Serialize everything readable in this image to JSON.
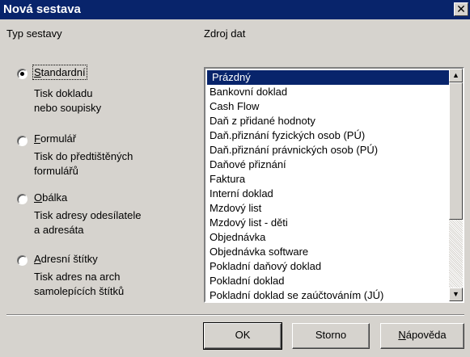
{
  "window": {
    "title": "Nová sestava",
    "close_glyph": "✕"
  },
  "left_panel": {
    "heading": "Typ sestavy",
    "options": [
      {
        "accel": "S",
        "rest": "tandardní",
        "desc1": "Tisk dokladu",
        "desc2": "nebo soupisky",
        "selected": true
      },
      {
        "accel": "F",
        "rest": "ormulář",
        "desc1": "Tisk do předtištěných",
        "desc2": "formulářů",
        "selected": false
      },
      {
        "accel": "O",
        "rest": "bálka",
        "desc1": "Tisk adresy odesílatele",
        "desc2": "a adresáta",
        "selected": false
      },
      {
        "accel": "A",
        "rest": "dresní štítky",
        "desc1": "Tisk adres na arch",
        "desc2": "samolepících štítků",
        "selected": false
      }
    ]
  },
  "right_panel": {
    "heading": "Zdroj dat",
    "items": [
      "Prázdný",
      "Bankovní doklad",
      "Cash Flow",
      "Daň z přidané hodnoty",
      "Daň.přiznání fyzických osob (PÚ)",
      "Daň.přiznání právnických osob (PÚ)",
      "Daňové přiznání",
      "Faktura",
      "Interní doklad",
      "Mzdový list",
      "Mzdový list - děti",
      "Objednávka",
      "Objednávka software",
      "Pokladní daňový doklad",
      "Pokladní doklad",
      "Pokladní doklad se zaúčtováním (JÚ)"
    ],
    "selected_index": 0,
    "scroll_up_glyph": "▲",
    "scroll_down_glyph": "▼"
  },
  "buttons": {
    "ok": "OK",
    "storno": "Storno",
    "help_accel": "N",
    "help_rest": "ápověda"
  },
  "colors": {
    "titlebar": "#08246b",
    "dialog_bg": "#d6d3ce",
    "selection": "#08246b"
  },
  "icons": {
    "close": "close-icon",
    "scroll_up": "scroll-up-arrow-icon",
    "scroll_down": "scroll-down-arrow-icon",
    "radio": "radio-button-icon"
  }
}
